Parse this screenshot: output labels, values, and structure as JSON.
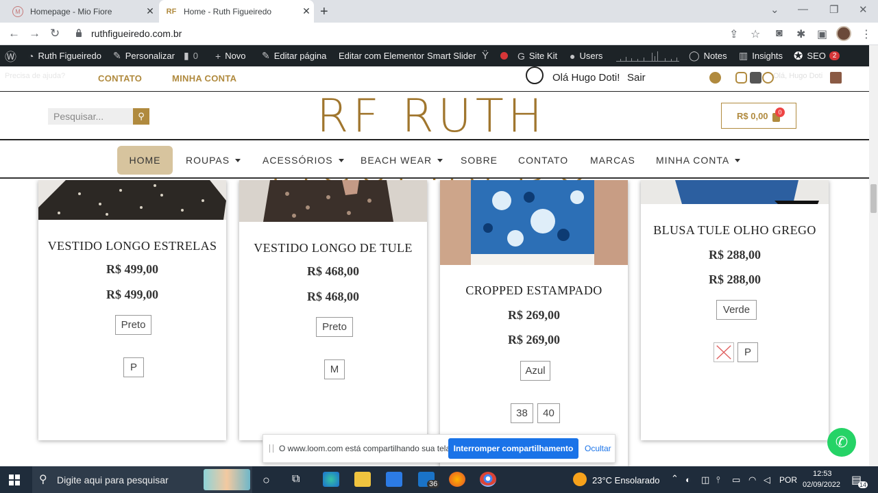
{
  "browser": {
    "tabs": [
      {
        "title": "Homepage - Mio Fiore",
        "active": false
      },
      {
        "title": "Home - Ruth Figueiredo",
        "active": true
      }
    ],
    "url": "ruthfigueiredo.com.br"
  },
  "wp_admin_bar": {
    "site_name": "Ruth Figueiredo",
    "customize": "Personalizar",
    "comments": "0",
    "new": "Novo",
    "edit_page": "Editar página",
    "edit_elementor": "Editar com Elementor",
    "smart_slider": "Smart Slider",
    "site_kit": "Site Kit",
    "users": "Users",
    "notes": "Notes",
    "insights": "Insights",
    "seo": "SEO",
    "seo_badge": "2"
  },
  "header": {
    "help_text": "Precisa de ajuda?",
    "links": [
      "CONTATO",
      "MINHA CONTA"
    ],
    "greeting": "Olá Hugo Doti!",
    "logout": "Sair",
    "ghost_greeting": "Olá, Hugo Doti",
    "search_placeholder": "Pesquisar...",
    "logo_text": "RF RUTH FIGUEIREDO",
    "cart_total": "R$ 0,00",
    "cart_count": "0"
  },
  "nav": {
    "items": [
      {
        "label": "HOME",
        "dropdown": false
      },
      {
        "label": "ROUPAS",
        "dropdown": true
      },
      {
        "label": "ACESSÓRIOS",
        "dropdown": true
      },
      {
        "label": "BEACH WEAR",
        "dropdown": true
      },
      {
        "label": "SOBRE",
        "dropdown": false
      },
      {
        "label": "CONTATO",
        "dropdown": false
      },
      {
        "label": "MARCAS",
        "dropdown": false
      },
      {
        "label": "MINHA CONTA",
        "dropdown": true
      }
    ]
  },
  "products": [
    {
      "name": "VESTIDO LONGO ESTRELAS",
      "price": "R$ 499,00",
      "price2": "R$ 499,00",
      "colors": [
        "Preto"
      ],
      "sizes": [
        "P"
      ]
    },
    {
      "name": "VESTIDO LONGO DE TULE",
      "price": "R$ 468,00",
      "price2": "R$ 468,00",
      "colors": [
        "Preto"
      ],
      "sizes": [
        "M"
      ]
    },
    {
      "name": "CROPPED ESTAMPADO",
      "price": "R$ 269,00",
      "price2": "R$ 269,00",
      "colors": [
        "Azul"
      ],
      "sizes": [
        "38",
        "40"
      ]
    },
    {
      "name": "BLUSA TULE OLHO GREGO",
      "price": "R$ 288,00",
      "price2": "R$ 288,00",
      "colors": [
        "Verde"
      ],
      "sizes": [
        "P"
      ]
    }
  ],
  "loom_notice": {
    "message": "O www.loom.com está compartilhando sua tela.",
    "stop_label": "Interromper compartilhamento",
    "hide_label": "Ocultar"
  },
  "taskbar": {
    "search_placeholder": "Digite aqui para pesquisar",
    "mail_badge": "36",
    "weather": "23°C  Ensolarado",
    "language": "POR",
    "time": "12:53",
    "date": "02/09/2022",
    "notif_count": "14"
  },
  "colors": {
    "accent_gold": "#b08a3e",
    "wp_bar": "#1d2327",
    "loom_blue": "#1a73e8",
    "whatsapp": "#25d366"
  }
}
